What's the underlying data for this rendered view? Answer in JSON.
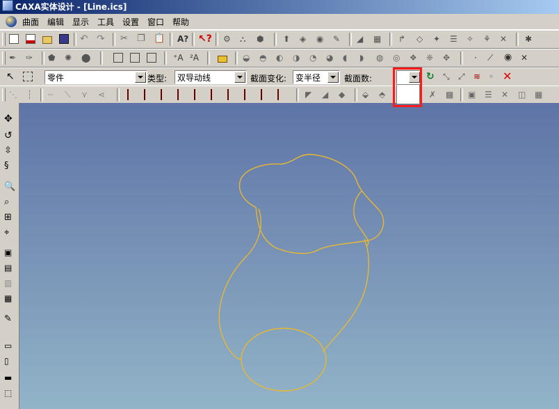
{
  "window": {
    "title": "CAXA实体设计 - [Line.ics]"
  },
  "menu": {
    "items": [
      "曲面",
      "编辑",
      "显示",
      "工具",
      "设置",
      "窗口",
      "帮助"
    ]
  },
  "surface_toolbar": {
    "part_combo": {
      "value": "零件"
    },
    "type_label": "类型:",
    "type_combo": {
      "value": "双导动线"
    },
    "section_change_label": "截面变化:",
    "section_change_combo": {
      "value": "变半径"
    },
    "section_count_label": "截面数:",
    "section_count_combo": {
      "value": ""
    }
  },
  "colors": {
    "curve": "#e8b830",
    "highlight": "#ff1a1a",
    "canvas_top": "#5e74a7",
    "canvas_bottom": "#92b4c8"
  }
}
